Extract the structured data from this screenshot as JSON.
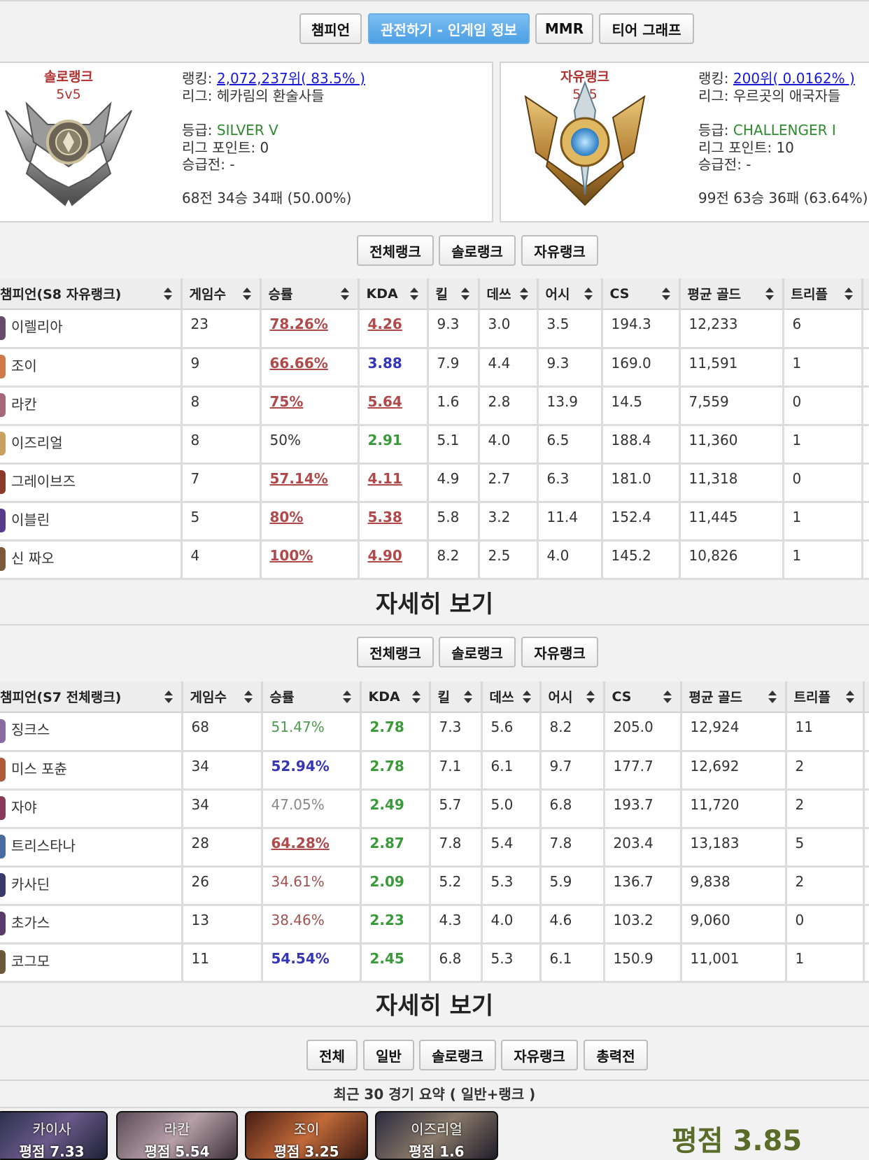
{
  "top_tabs": [
    {
      "label": "챔피언",
      "active": false
    },
    {
      "label": "관전하기 - 인게임 정보",
      "active": true
    },
    {
      "label": "MMR",
      "active": false
    },
    {
      "label": "티어 그래프",
      "active": false
    }
  ],
  "solo": {
    "title": "솔로랭크",
    "subtitle": "5v5",
    "ranking_label": "랭킹: ",
    "ranking": "2,072,237위",
    "ranking_pct": "( 83.5% )",
    "league": "리그: 헤카림의 환술사들",
    "tier_label": "등급: ",
    "tier": "SILVER V",
    "lp": "리그 포인트: 0",
    "promo": "승급전: -",
    "record": "68전 34승 34패 (50.00%)"
  },
  "flex": {
    "title": "자유랭크",
    "subtitle": "5v5",
    "ranking_label": "랭킹: ",
    "ranking": "200위",
    "ranking_pct": "( 0.0162% )",
    "league": "리그: 우르곳의 애국자들",
    "tier_label": "등급: ",
    "tier": "CHALLENGER I",
    "lp": "리그 포인트: 10",
    "promo": "승급전: -",
    "record": "99전 63승 36패 (63.64%)"
  },
  "queue_tabs": [
    "전체랭크",
    "솔로랭크",
    "자유랭크"
  ],
  "table1": {
    "headers": [
      "챔피언(S8 자유랭크)",
      "게임수",
      "승률",
      "KDA",
      "킬",
      "데쓰",
      "어시",
      "CS",
      "평균 골드",
      "트리플"
    ],
    "rows": [
      {
        "champ": "이렐리아",
        "games": "23",
        "wr": "78.26%",
        "kda": "4.26",
        "k": "9.3",
        "d": "3.0",
        "a": "3.5",
        "cs": "194.3",
        "gold": "12,233",
        "triple": "6"
      },
      {
        "champ": "조이",
        "games": "9",
        "wr": "66.66%",
        "kda": "3.88",
        "k": "7.9",
        "d": "4.4",
        "a": "9.3",
        "cs": "169.0",
        "gold": "11,591",
        "triple": "1"
      },
      {
        "champ": "라칸",
        "games": "8",
        "wr": "75%",
        "kda": "5.64",
        "k": "1.6",
        "d": "2.8",
        "a": "13.9",
        "cs": "14.5",
        "gold": "7,559",
        "triple": "0"
      },
      {
        "champ": "이즈리얼",
        "games": "8",
        "wr": "50%",
        "kda": "2.91",
        "k": "5.1",
        "d": "4.0",
        "a": "6.5",
        "cs": "188.4",
        "gold": "11,360",
        "triple": "1"
      },
      {
        "champ": "그레이브즈",
        "games": "7",
        "wr": "57.14%",
        "kda": "4.11",
        "k": "4.9",
        "d": "2.7",
        "a": "6.3",
        "cs": "181.0",
        "gold": "11,318",
        "triple": "0"
      },
      {
        "champ": "이블린",
        "games": "5",
        "wr": "80%",
        "kda": "5.38",
        "k": "5.8",
        "d": "3.2",
        "a": "11.4",
        "cs": "152.4",
        "gold": "11,445",
        "triple": "1"
      },
      {
        "champ": "신 짜오",
        "games": "4",
        "wr": "100%",
        "kda": "4.90",
        "k": "8.2",
        "d": "2.5",
        "a": "4.0",
        "cs": "145.2",
        "gold": "10,826",
        "triple": "1"
      }
    ]
  },
  "more_label": "자세히 보기",
  "table2": {
    "headers": [
      "챔피언(S7 전체랭크)",
      "게임수",
      "승률",
      "KDA",
      "킬",
      "데쓰",
      "어시",
      "CS",
      "평균 골드",
      "트리플"
    ],
    "rows": [
      {
        "champ": "징크스",
        "games": "68",
        "wr": "51.47%",
        "kda": "2.78",
        "k": "7.3",
        "d": "5.6",
        "a": "8.2",
        "cs": "205.0",
        "gold": "12,924",
        "triple": "11"
      },
      {
        "champ": "미스 포츈",
        "games": "34",
        "wr": "52.94%",
        "kda": "2.78",
        "k": "7.1",
        "d": "6.1",
        "a": "9.7",
        "cs": "177.7",
        "gold": "12,692",
        "triple": "2"
      },
      {
        "champ": "자야",
        "games": "34",
        "wr": "47.05%",
        "kda": "2.49",
        "k": "5.7",
        "d": "5.0",
        "a": "6.8",
        "cs": "193.7",
        "gold": "11,720",
        "triple": "2"
      },
      {
        "champ": "트리스타나",
        "games": "28",
        "wr": "64.28%",
        "kda": "2.87",
        "k": "7.8",
        "d": "5.4",
        "a": "7.8",
        "cs": "203.4",
        "gold": "13,183",
        "triple": "5"
      },
      {
        "champ": "카사딘",
        "games": "26",
        "wr": "34.61%",
        "kda": "2.09",
        "k": "5.2",
        "d": "5.3",
        "a": "5.9",
        "cs": "136.7",
        "gold": "9,838",
        "triple": "2"
      },
      {
        "champ": "초가스",
        "games": "13",
        "wr": "38.46%",
        "kda": "2.23",
        "k": "4.3",
        "d": "4.0",
        "a": "4.6",
        "cs": "103.2",
        "gold": "9,060",
        "triple": "0"
      },
      {
        "champ": "코그모",
        "games": "11",
        "wr": "54.54%",
        "kda": "2.45",
        "k": "6.8",
        "d": "5.3",
        "a": "6.1",
        "cs": "150.9",
        "gold": "11,001",
        "triple": "1"
      }
    ]
  },
  "game_tabs": [
    "전체",
    "일반",
    "솔로랭크",
    "자유랭크",
    "총력전"
  ],
  "summary_title": "최근 30 경기 요약 ( 일반+랭크 )",
  "recent_champs": [
    {
      "name": "카이사",
      "score": "평점 7.33"
    },
    {
      "name": "라칸",
      "score": "평점 5.54"
    },
    {
      "name": "조이",
      "score": "평점 3.25"
    },
    {
      "name": "이즈리얼",
      "score": "평점 1.6"
    }
  ],
  "overall_score": "평점 3.85",
  "colors": {
    "accent": "#5aa8ec",
    "green": "#2f8a2f",
    "red": "#b04a4a",
    "blue": "#3535b8",
    "tier_title": "#b03030"
  }
}
